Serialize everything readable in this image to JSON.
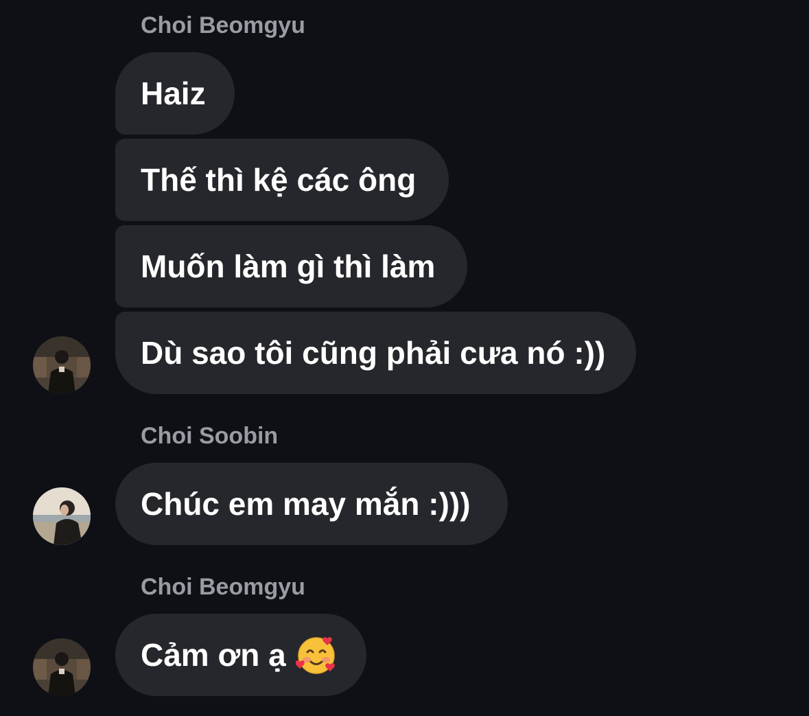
{
  "messages": [
    {
      "sender": "Choi Beomgyu",
      "bubbles": [
        "Haiz",
        "Thế thì kệ các ông",
        "Muốn làm gì thì làm",
        "Dù sao tôi cũng phải cưa nó :))"
      ]
    },
    {
      "sender": "Choi Soobin",
      "bubbles": [
        "Chúc em may mắn :)))"
      ]
    },
    {
      "sender": "Choi Beomgyu",
      "bubbles": [
        "Cảm ơn ạ"
      ],
      "emoji": "smiling-face-with-hearts"
    }
  ],
  "colors": {
    "background": "#0e1015",
    "bubble": "#25272c",
    "sender_name": "#9a9ca3",
    "text": "#ffffff"
  }
}
